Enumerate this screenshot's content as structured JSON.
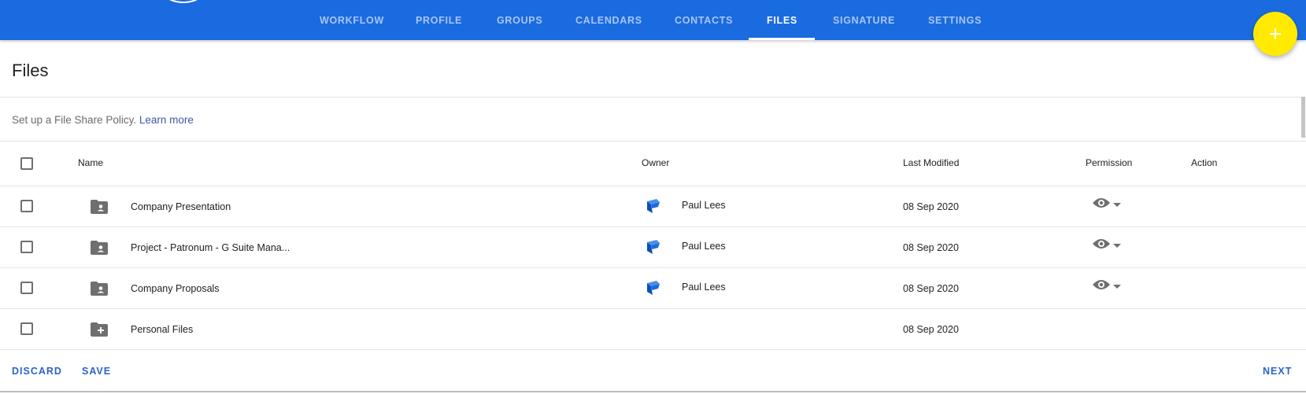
{
  "nav": {
    "tabs": [
      {
        "label": "WORKFLOW",
        "active": false
      },
      {
        "label": "PROFILE",
        "active": false
      },
      {
        "label": "GROUPS",
        "active": false
      },
      {
        "label": "CALENDARS",
        "active": false
      },
      {
        "label": "CONTACTS",
        "active": false
      },
      {
        "label": "FILES",
        "active": true
      },
      {
        "label": "SIGNATURE",
        "active": false
      },
      {
        "label": "SETTINGS",
        "active": false
      }
    ],
    "fab_icon": "plus-icon"
  },
  "page": {
    "title": "Files",
    "policy_text": "Set up a File Share Policy. ",
    "policy_link": "Learn more"
  },
  "table": {
    "headers": {
      "name": "Name",
      "owner": "Owner",
      "modified": "Last Modified",
      "permission": "Permission",
      "action": "Action"
    },
    "rows": [
      {
        "name": "Company Presentation",
        "icon": "shared-folder-icon",
        "owner": "Paul Lees",
        "modified": "08 Sep 2020",
        "permission_icon": "eye-icon"
      },
      {
        "name": "Project - Patronum - G Suite Mana...",
        "icon": "shared-folder-icon",
        "owner": "Paul Lees",
        "modified": "08 Sep 2020",
        "permission_icon": "eye-icon"
      },
      {
        "name": "Company Proposals",
        "icon": "shared-folder-icon",
        "owner": "Paul Lees",
        "modified": "08 Sep 2020",
        "permission_icon": "eye-icon"
      },
      {
        "name": "Personal Files",
        "icon": "add-folder-icon",
        "owner": "",
        "modified": "08 Sep 2020",
        "permission_icon": ""
      }
    ]
  },
  "footer": {
    "discard": "DISCARD",
    "save": "SAVE",
    "next": "NEXT"
  },
  "colors": {
    "header_blue": "#1a6ae0",
    "fab_yellow": "#ffea00",
    "link_blue": "#3c5aa8",
    "icon_grey": "#6f6f6f"
  }
}
